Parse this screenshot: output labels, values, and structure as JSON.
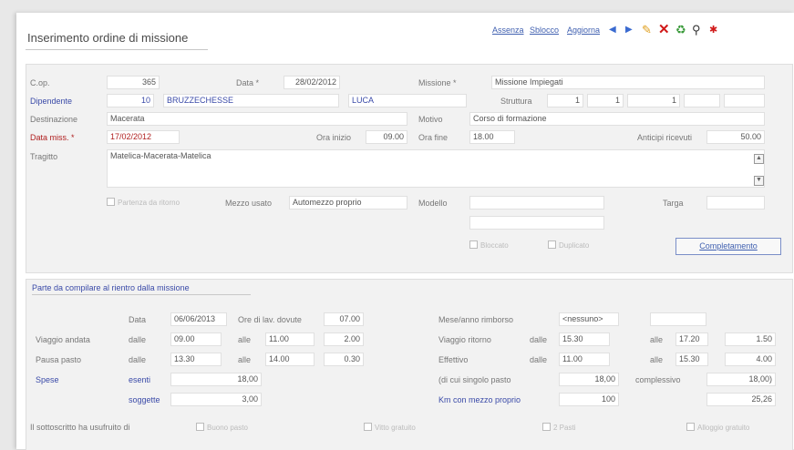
{
  "title": "Inserimento ordine di missione",
  "toolbar": {
    "links": [
      "Assenza",
      "Sblocco",
      "Aggiorna"
    ],
    "icons": [
      "arrow-left-icon",
      "arrow-right-icon",
      "edit-pencil-icon",
      "delete-x-icon",
      "recycle-icon",
      "binoculars-icon",
      "stop-icon"
    ]
  },
  "form": {
    "cop": {
      "label": "C.op.",
      "value": "365"
    },
    "data": {
      "label": "Data *",
      "value": "28/02/2012"
    },
    "missione": {
      "label": "Missione *",
      "value": "Missione Impiegati"
    },
    "dipendente": {
      "label": "Dipendente",
      "code": "10",
      "cognome": "BRUZZECHESSE",
      "nome": "LUCA"
    },
    "struttura": {
      "label": "Struttura",
      "values": [
        "1",
        "1",
        "1",
        "",
        ""
      ]
    },
    "destinazione": {
      "label": "Destinazione",
      "value": "Macerata"
    },
    "motivo": {
      "label": "Motivo",
      "value": "Corso di formazione"
    },
    "data_miss": {
      "label": "Data miss. *",
      "value": "17/02/2012"
    },
    "ora_inizio": {
      "label": "Ora inizio",
      "value": "09.00"
    },
    "ora_fine": {
      "label": "Ora fine",
      "value": "18.00"
    },
    "anticipi": {
      "label": "Anticipi ricevuti",
      "value": "50.00"
    },
    "tragitto": {
      "label": "Tragitto",
      "value": "Matelica-Macerata-Matelica"
    },
    "partenza": {
      "label": "Partenza da ritorno"
    },
    "mezzo": {
      "label": "Mezzo usato",
      "value": "Automezzo proprio"
    },
    "modello": {
      "label": "Modello",
      "value": ""
    },
    "targa": {
      "label": "Targa",
      "value": ""
    },
    "bloccato": {
      "label": "Bloccato"
    },
    "duplicato": {
      "label": "Duplicato"
    },
    "completamento": "Completamento"
  },
  "rientro": {
    "title": "Parte da compilare al rientro dalla missione",
    "data_label": "Data",
    "data_value": "06/06/2013",
    "ore_label": "Ore di lav. dovute",
    "ore_value": "07.00",
    "mese_label": "Mese/anno rimborso",
    "mese_value": "<nessuno>",
    "mese_extra": "",
    "viaggio_andata": {
      "label": "Viaggio andata",
      "dalle": "09.00",
      "alle": "11.00",
      "tot": "2.00"
    },
    "pausa": {
      "label": "Pausa pasto",
      "dalle": "13.30",
      "alle": "14.00",
      "tot": "0.30"
    },
    "viaggio_ritorno": {
      "label": "Viaggio ritorno",
      "dalle": "15.30",
      "alle": "17.20",
      "tot": "1.50"
    },
    "effettivo": {
      "label": "Effettivo",
      "dalle": "11.00",
      "alle": "15.30",
      "tot": "4.00"
    },
    "dalle_label": "dalle",
    "alle_label": "alle",
    "spese": {
      "label": "Spese",
      "esenti_label": "esenti",
      "esenti": "18,00",
      "soggette_label": "soggette",
      "soggette": "3,00"
    },
    "singolo_pasto": {
      "label": "(di cui singolo pasto",
      "value": "18,00",
      "compl_label": "complessivo",
      "compl_value": "18,00)"
    },
    "km": {
      "label": "Km con mezzo proprio",
      "value": "100",
      "importo": "25,26"
    },
    "usufruito_label": "Il sottoscritto ha usufruito di",
    "checks": [
      "Buono pasto",
      "Vitto gratuito",
      "2 Pasti",
      "Alloggio gratuito"
    ]
  }
}
